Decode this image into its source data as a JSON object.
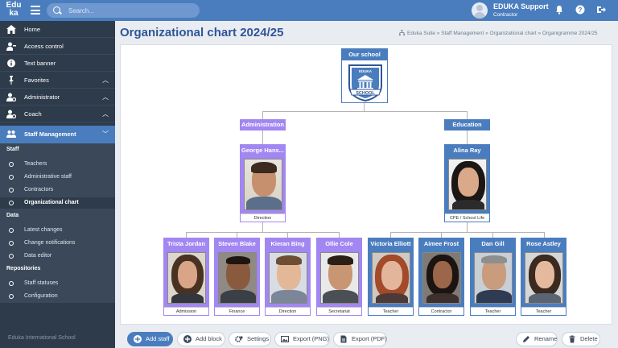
{
  "app": {
    "logo_line1": "Edu",
    "logo_line2": "ka"
  },
  "search": {
    "placeholder": "Search..."
  },
  "user": {
    "name": "EDUKA Support",
    "role": "Contractor"
  },
  "header_icons": [
    "bell-icon",
    "help-icon",
    "logout-icon"
  ],
  "sidebar": {
    "items": [
      {
        "label": "Home",
        "icon": "home-icon"
      },
      {
        "label": "Access control",
        "icon": "user-key-icon"
      },
      {
        "label": "Text banner",
        "icon": "info-icon"
      },
      {
        "label": "Favorites",
        "icon": "pin-icon",
        "chevron": "up"
      },
      {
        "label": "Administrator",
        "icon": "user-gear-icon",
        "chevron": "up"
      },
      {
        "label": "Coach",
        "icon": "user-gear-icon",
        "chevron": "up"
      },
      {
        "label": "Staff Management",
        "icon": "staff-icon",
        "chevron": "down"
      }
    ],
    "sections": [
      {
        "title": "Staff",
        "links": [
          "Teachers",
          "Administrative staff",
          "Contractors",
          "Organizational chart"
        ]
      },
      {
        "title": "Data",
        "links": [
          "Latest changes",
          "Change notifications",
          "Data editor"
        ]
      },
      {
        "title": "Repositories",
        "links": [
          "Staff statuses",
          "Configuration"
        ]
      }
    ],
    "current": "Organizational chart",
    "footer": "Eduka International School"
  },
  "page": {
    "title": "Organizational chart 2024/25",
    "breadcrumb": "Eduka Suite » Staff Management » Organizational chart » Organigramme 2024/25"
  },
  "chart": {
    "root": {
      "title": "Our school",
      "badge_top": "EDUKA",
      "badge_bottom": "SCHOOL"
    },
    "groups": [
      {
        "label": "Administration",
        "color": "#a286f2",
        "head": {
          "name": "George Hans...",
          "role": "Direction"
        }
      },
      {
        "label": "Education",
        "color": "#4a7dbe",
        "head": {
          "name": "Alina Ray",
          "role": "CPE / School Life"
        }
      }
    ],
    "admin_staff": [
      {
        "name": "Trista Jordan",
        "role": "Admission"
      },
      {
        "name": "Steven Blake",
        "role": "Finance"
      },
      {
        "name": "Kieran Bing",
        "role": "Direction"
      },
      {
        "name": "Ollie Cole",
        "role": "Secretariat"
      }
    ],
    "edu_staff": [
      {
        "name": "Victoria Elliott",
        "role": "Teacher"
      },
      {
        "name": "Aimee Frost",
        "role": "Contractor"
      },
      {
        "name": "Dan Gill",
        "role": "Teacher"
      },
      {
        "name": "Rose Astley",
        "role": "Teacher"
      }
    ]
  },
  "toolbar": {
    "add_staff": "Add staff",
    "add_block": "Add block",
    "settings": "Settings",
    "export_png": "Export (PNG)",
    "export_pdf": "Export (PDF)",
    "rename": "Rename",
    "delete": "Delete"
  }
}
